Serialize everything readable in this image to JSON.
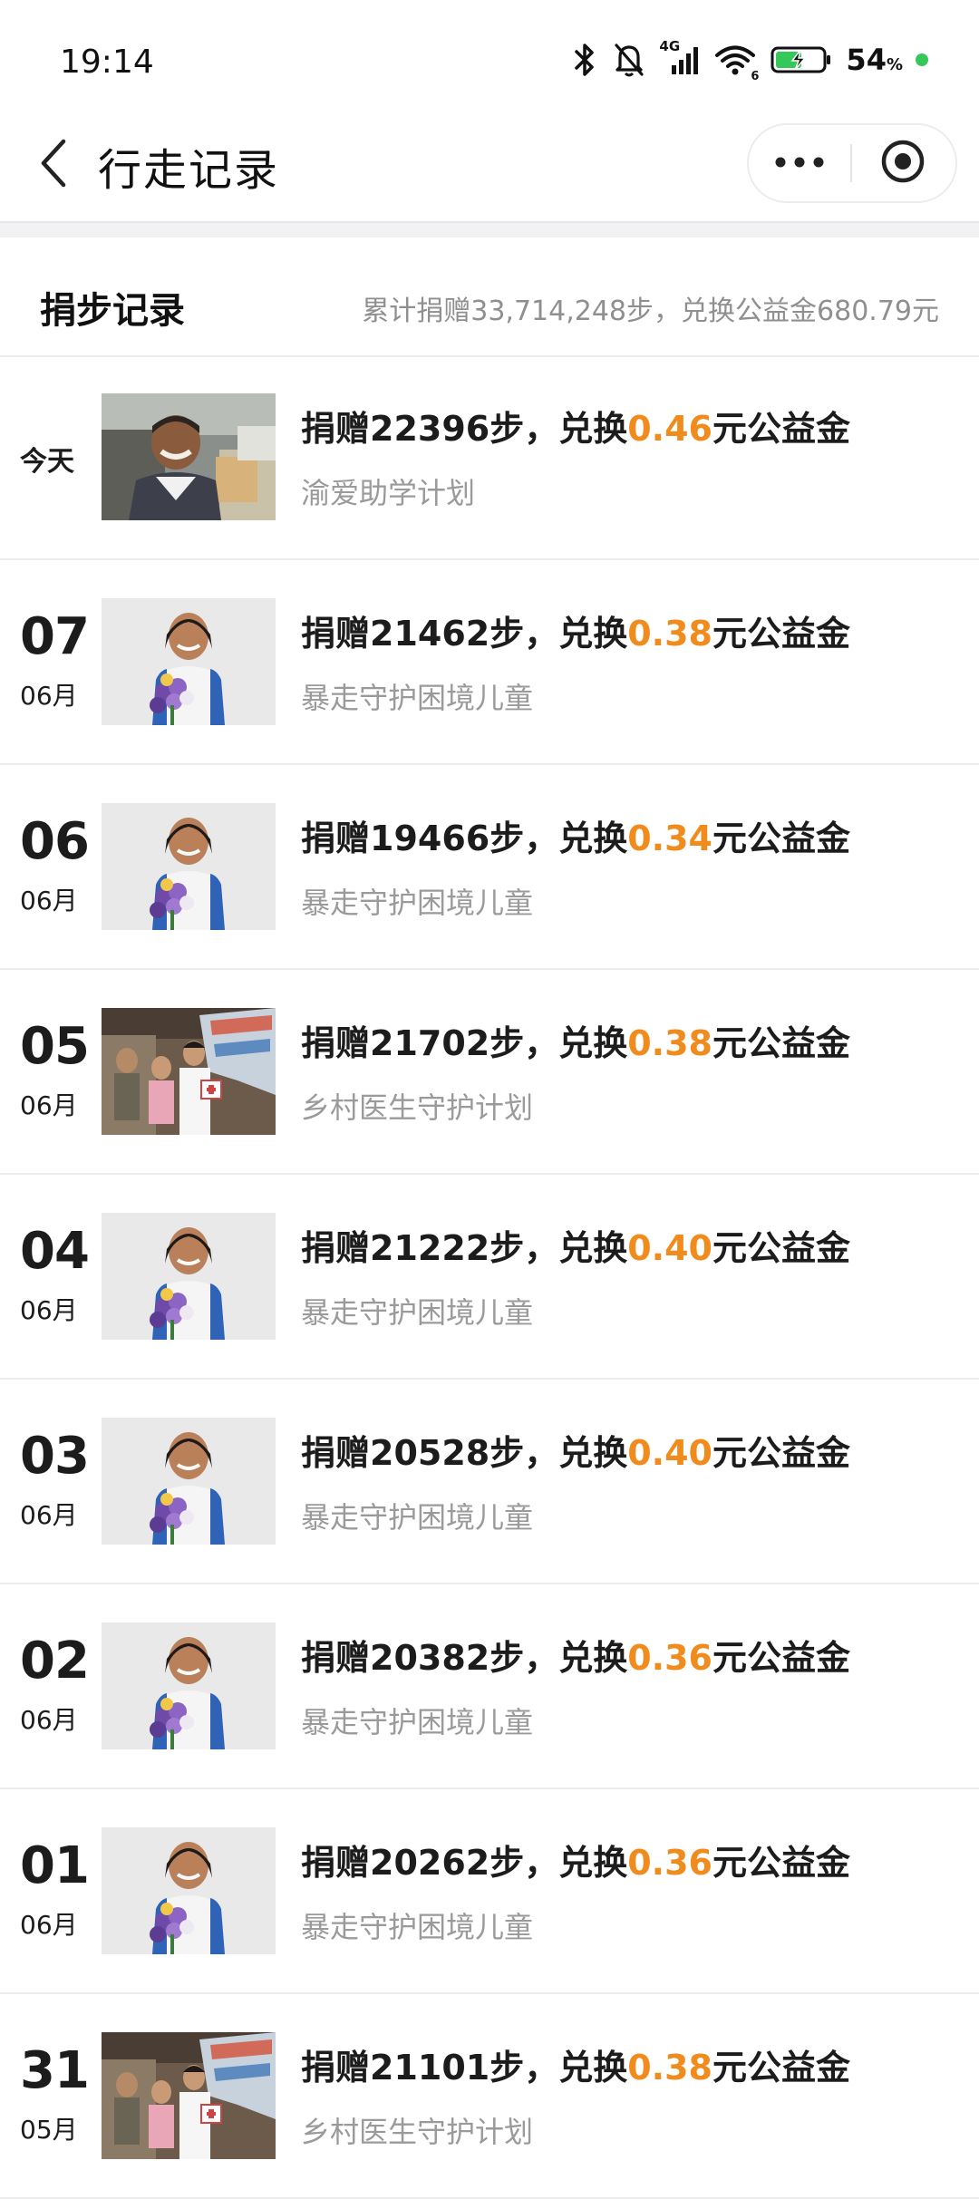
{
  "status_bar": {
    "time": "19:14",
    "network_label": "4G",
    "wifi_label": "6",
    "battery_percent": "54",
    "battery_unit": "%",
    "icons": [
      "bluetooth-icon",
      "bell-muted-icon",
      "signal-icon",
      "wifi-icon",
      "battery-charging-icon"
    ]
  },
  "nav": {
    "title": "行走记录",
    "back_icon": "chevron-left-icon",
    "more_icon": "more-dots-icon",
    "close_icon": "target-close-icon"
  },
  "summary": {
    "title": "捐步记录",
    "text": "累计捐赠33,714,248步，兑换公益金680.79元"
  },
  "records": [
    {
      "today": "今天",
      "day": "",
      "month": "",
      "pre": "捐赠22396步，兑换",
      "amount": "0.46",
      "post": "元公益金",
      "project": "渝爱助学计划",
      "image": "boy"
    },
    {
      "today": "",
      "day": "07",
      "month": "06月",
      "pre": "捐赠21462步，兑换",
      "amount": "0.38",
      "post": "元公益金",
      "project": "暴走守护困境儿童",
      "image": "girl"
    },
    {
      "today": "",
      "day": "06",
      "month": "06月",
      "pre": "捐赠19466步，兑换",
      "amount": "0.34",
      "post": "元公益金",
      "project": "暴走守护困境儿童",
      "image": "girl"
    },
    {
      "today": "",
      "day": "05",
      "month": "06月",
      "pre": "捐赠21702步，兑换",
      "amount": "0.38",
      "post": "元公益金",
      "project": "乡村医生守护计划",
      "image": "doctor"
    },
    {
      "today": "",
      "day": "04",
      "month": "06月",
      "pre": "捐赠21222步，兑换",
      "amount": "0.40",
      "post": "元公益金",
      "project": "暴走守护困境儿童",
      "image": "girl"
    },
    {
      "today": "",
      "day": "03",
      "month": "06月",
      "pre": "捐赠20528步，兑换",
      "amount": "0.40",
      "post": "元公益金",
      "project": "暴走守护困境儿童",
      "image": "girl"
    },
    {
      "today": "",
      "day": "02",
      "month": "06月",
      "pre": "捐赠20382步，兑换",
      "amount": "0.36",
      "post": "元公益金",
      "project": "暴走守护困境儿童",
      "image": "girl"
    },
    {
      "today": "",
      "day": "01",
      "month": "06月",
      "pre": "捐赠20262步，兑换",
      "amount": "0.36",
      "post": "元公益金",
      "project": "暴走守护困境儿童",
      "image": "girl"
    },
    {
      "today": "",
      "day": "31",
      "month": "05月",
      "pre": "捐赠21101步，兑换",
      "amount": "0.38",
      "post": "元公益金",
      "project": "乡村医生守护计划",
      "image": "doctor"
    }
  ],
  "colors": {
    "amount": "#f08c1e",
    "muted_text": "#9a9a9a",
    "divider": "#ececec"
  }
}
